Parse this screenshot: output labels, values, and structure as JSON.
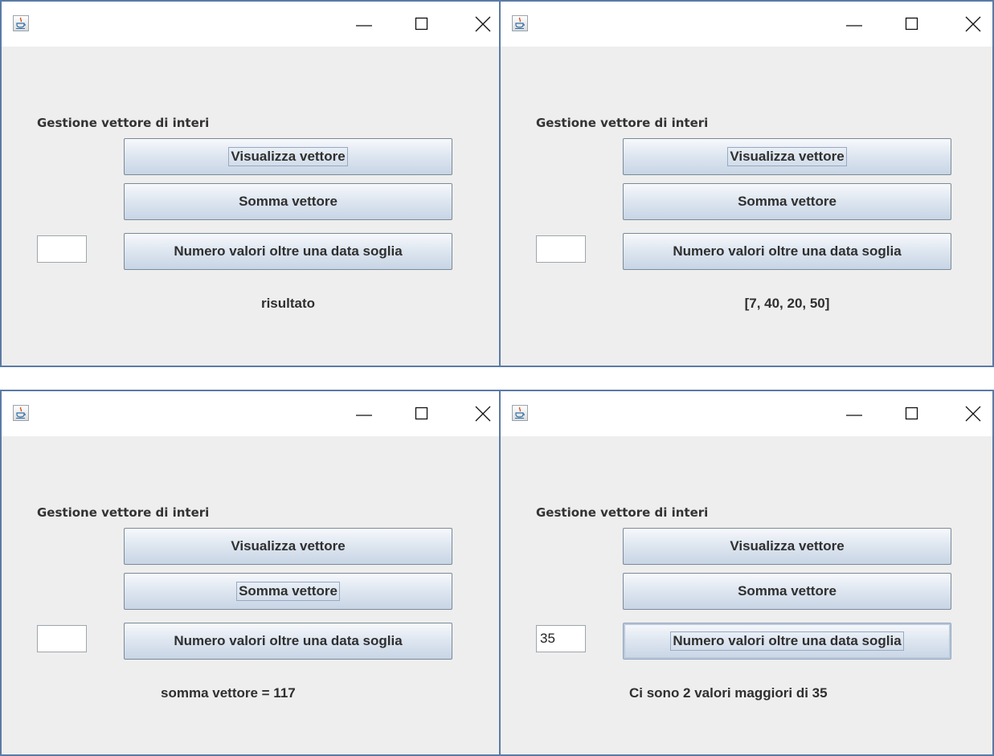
{
  "colors": {
    "window_border": "#5b7aa5",
    "client_bg": "#eeeeee",
    "titlebar_bg": "#ffffff",
    "button_gradient_top": "#f7f9fc",
    "button_gradient_bottom": "#c8d5e5"
  },
  "windows": [
    {
      "title": "",
      "app_icon": "java-cup-icon",
      "heading": "Gestione vettore di interi",
      "buttons": {
        "show": "Visualizza vettore",
        "sum": "Somma vettore",
        "threshold": "Numero valori oltre una data soglia"
      },
      "threshold_input_value": "",
      "focused_button": "show",
      "result": "risultato"
    },
    {
      "title": "",
      "app_icon": "java-cup-icon",
      "heading": "Gestione vettore di interi",
      "buttons": {
        "show": "Visualizza vettore",
        "sum": "Somma vettore",
        "threshold": "Numero valori oltre una data soglia"
      },
      "threshold_input_value": "",
      "focused_button": "show",
      "result": "[7, 40, 20, 50]"
    },
    {
      "title": "",
      "app_icon": "java-cup-icon",
      "heading": "Gestione vettore di interi",
      "buttons": {
        "show": "Visualizza vettore",
        "sum": "Somma vettore",
        "threshold": "Numero valori oltre una data soglia"
      },
      "threshold_input_value": "",
      "focused_button": "sum",
      "result": "somma vettore = 117"
    },
    {
      "title": "",
      "app_icon": "java-cup-icon",
      "heading": "Gestione vettore di interi",
      "buttons": {
        "show": "Visualizza vettore",
        "sum": "Somma vettore",
        "threshold": "Numero valori oltre una data soglia"
      },
      "threshold_input_value": "35",
      "focused_button": "threshold",
      "result": "Ci sono 2 valori maggiori di 35"
    }
  ]
}
